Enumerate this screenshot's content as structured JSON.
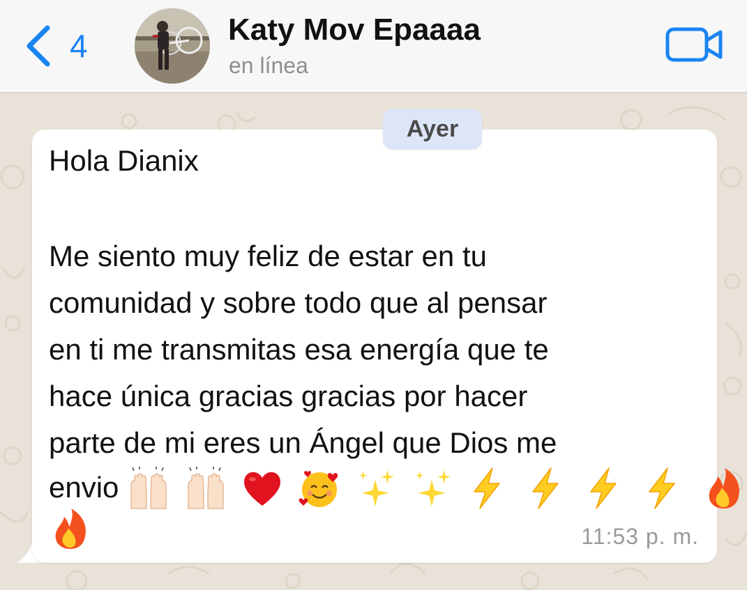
{
  "header": {
    "back_count": "4",
    "contact_name": "Katy Mov Epaaaa",
    "status": "en línea"
  },
  "chat": {
    "date_separator": "Ayer",
    "message": {
      "greeting": "Hola Dianix",
      "body_lines": [
        "Me siento muy feliz de estar en tu",
        "comunidad y sobre todo que al pensar",
        "en ti me transmitas esa energía que te",
        "hace única gracias gracias por hacer",
        "parte de mi eres un Ángel que Dios me"
      ],
      "last_word": "envio",
      "emojis": [
        "raising-hands-icon",
        "raising-hands-icon",
        "red-heart-icon",
        "smiling-face-with-hearts-icon",
        "sparkles-icon",
        "sparkles-icon",
        "high-voltage-icon",
        "high-voltage-icon",
        "high-voltage-icon",
        "high-voltage-icon",
        "fire-icon",
        "fire-icon"
      ],
      "time": "11:53 p. m."
    }
  },
  "colors": {
    "accent": "#1a84f2",
    "header_bg": "#f7f7f7",
    "wallpaper": "#e9e2d8",
    "bubble": "#ffffff",
    "date_pill": "#dde5f8"
  }
}
